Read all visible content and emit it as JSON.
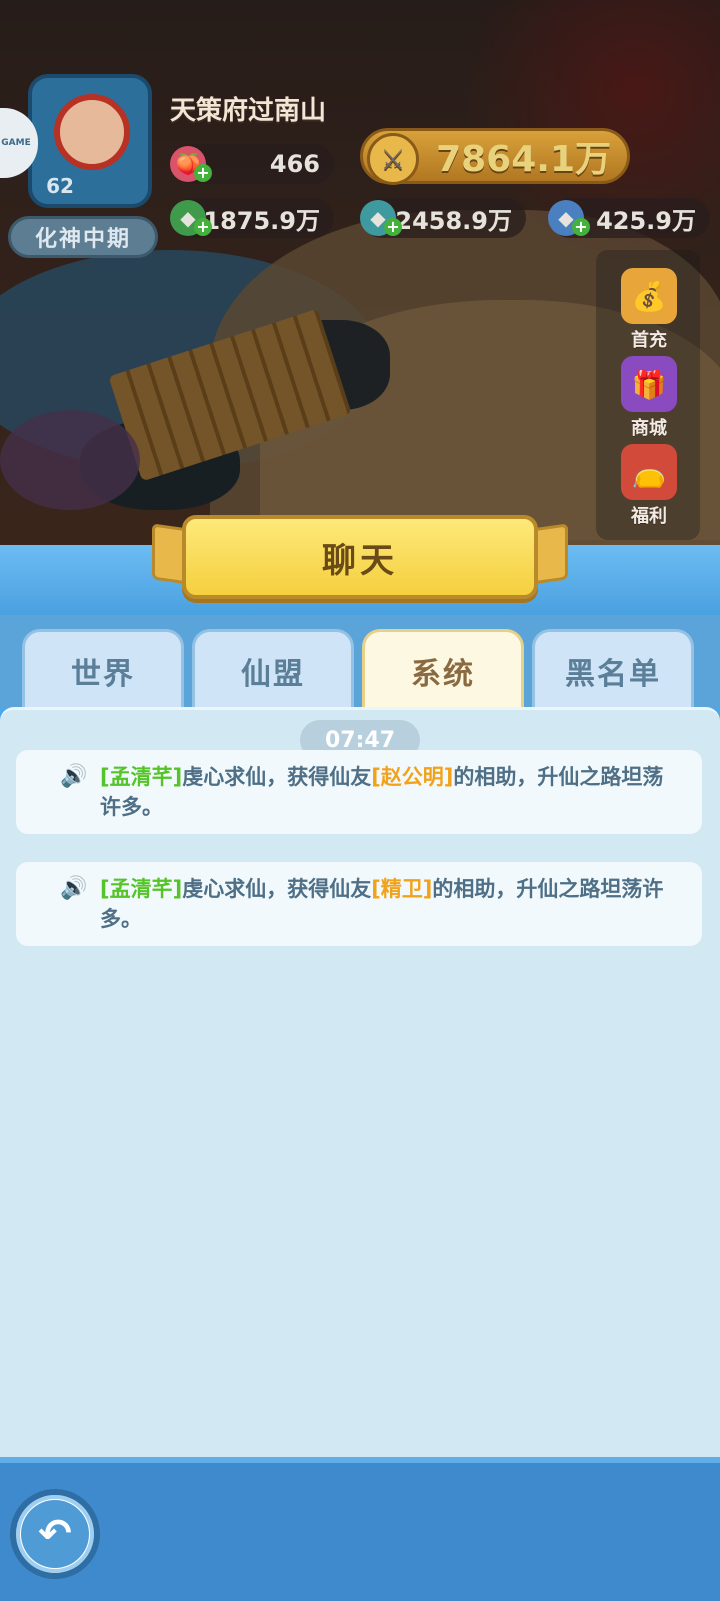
{
  "player": {
    "name": "天策府过南山",
    "level": "62",
    "realm": "化神中期",
    "side_badge": "GAME"
  },
  "resources": {
    "stamina": "466",
    "power": "7864.1万",
    "res_green": "1875.9万",
    "res_teal": "2458.9万",
    "res_blue": "425.9万"
  },
  "right_menu": [
    {
      "label": "首充",
      "icon": "first-recharge-icon"
    },
    {
      "label": "商城",
      "icon": "gift-box-icon"
    },
    {
      "label": "福利",
      "icon": "welfare-bag-icon"
    }
  ],
  "chat": {
    "title": "聊天",
    "tabs": [
      {
        "label": "世界",
        "active": false
      },
      {
        "label": "仙盟",
        "active": false
      },
      {
        "label": "系统",
        "active": true
      },
      {
        "label": "黑名单",
        "active": false
      }
    ],
    "time": "07:47",
    "messages": [
      {
        "player": "[孟清芊]",
        "text1": "虔心求仙，获得仙友",
        "friend": "[赵公明]",
        "text2": "的相助，升仙之路坦荡许多。"
      },
      {
        "player": "[孟清芊]",
        "text1": "虔心求仙，获得仙友",
        "friend": "[精卫]",
        "text2": "的相助，升仙之路坦荡许多。"
      }
    ]
  },
  "colors": {
    "accent_blue": "#4ea7e6",
    "title_gold": "#f5cf3e",
    "name_green": "#55c429",
    "name_orange": "#f2a21a"
  }
}
